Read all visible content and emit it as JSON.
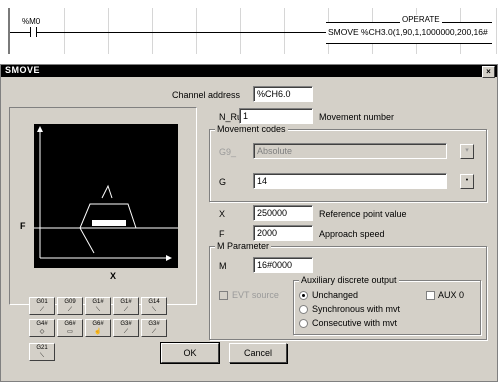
{
  "ladder": {
    "contact_label": "%M0",
    "coil_title": "OPERATE",
    "coil_text": "SMOVE %CH3.0(1,90,1,1000000,200,16#"
  },
  "window": {
    "title": "SMOVE",
    "close_glyph": "×"
  },
  "preview": {
    "axis_f": "F",
    "axis_x": "X"
  },
  "form": {
    "channel_label": "Channel address",
    "channel_value": "%CH6.0",
    "nrun_label": "N_Run",
    "nrun_value": "1",
    "nrun_desc": "Movement number",
    "movement_group": "Movement codes",
    "g9_label": "G9_",
    "g9_value": "Absolute",
    "g_label": "G",
    "g_value": "14",
    "x_label": "X",
    "x_value": "250000",
    "x_desc": "Reference point value",
    "f_label": "F",
    "f_value": "2000",
    "f_desc": "Approach speed",
    "mparam_group": "M Parameter",
    "m_label": "M",
    "m_value": "16#0000",
    "aux_group": "Auxiliary discrete output",
    "evt_label": "EVT source",
    "aux0_label": "AUX 0",
    "radio_unchanged": "Unchanged",
    "radio_sync": "Synchronous with mvt",
    "radio_consec": "Consecutive with mvt",
    "ok_label": "OK",
    "cancel_label": "Cancel"
  },
  "toolbar": {
    "row1": [
      "G01",
      "G09",
      "G1#",
      "G1#",
      "G14"
    ],
    "row2": [
      "G4#",
      "G6#",
      "G6#",
      "G3#",
      "G3#"
    ],
    "row3": [
      "G21"
    ]
  }
}
